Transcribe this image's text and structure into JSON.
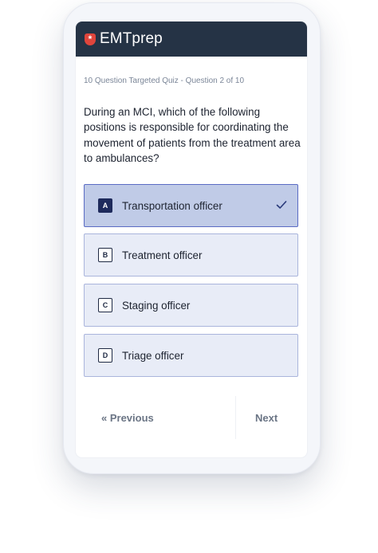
{
  "app": {
    "logo_symbol": "*",
    "logo_text": "EMTprep"
  },
  "quiz": {
    "subtitle": "10 Question Targeted Quiz - Question 2 of 10",
    "question": "During an MCI, which of the following positions is responsible for coordinating the movement of patients from the treatment area to ambulances?",
    "options": [
      {
        "letter": "A",
        "label": "Transportation officer",
        "selected": true
      },
      {
        "letter": "B",
        "label": "Treatment officer",
        "selected": false
      },
      {
        "letter": "C",
        "label": "Staging officer",
        "selected": false
      },
      {
        "letter": "D",
        "label": "Triage officer",
        "selected": false
      }
    ]
  },
  "nav": {
    "previous": "« Previous",
    "next": "Next"
  },
  "colors": {
    "header": "#253345",
    "brand_red": "#e0453c",
    "selected_bg": "#c0cbe7",
    "option_bg": "#e8ecf7"
  }
}
